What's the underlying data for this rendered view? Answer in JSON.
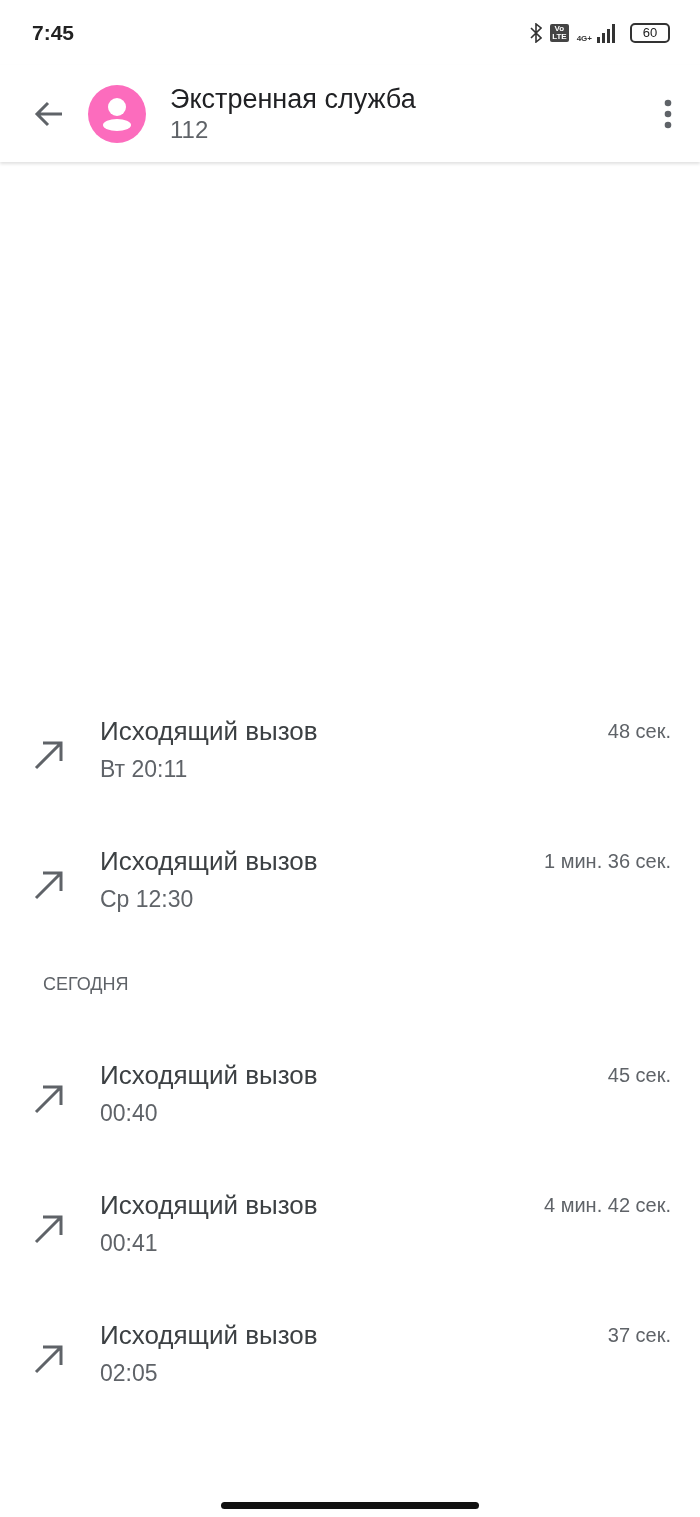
{
  "status_bar": {
    "time": "7:45",
    "volte": [
      "Vo",
      "LTE"
    ],
    "network": "4G+",
    "battery": "60"
  },
  "header": {
    "title": "Экстренная служба",
    "subtitle": "112"
  },
  "sections": [
    {
      "calls": [
        {
          "kind": "outgoing",
          "title": "Исходящий вызов",
          "time": "Вт 20:11",
          "duration": "48 сек."
        },
        {
          "kind": "outgoing",
          "title": "Исходящий вызов",
          "time": "Ср 12:30",
          "duration": "1 мин. 36 сек."
        }
      ]
    },
    {
      "heading": "СЕГОДНЯ",
      "calls": [
        {
          "kind": "outgoing",
          "title": "Исходящий вызов",
          "time": "00:40",
          "duration": "45 сек."
        },
        {
          "kind": "outgoing",
          "title": "Исходящий вызов",
          "time": "00:41",
          "duration": "4 мин. 42 сек."
        },
        {
          "kind": "outgoing",
          "title": "Исходящий вызов",
          "time": "02:05",
          "duration": "37 сек."
        }
      ]
    }
  ]
}
